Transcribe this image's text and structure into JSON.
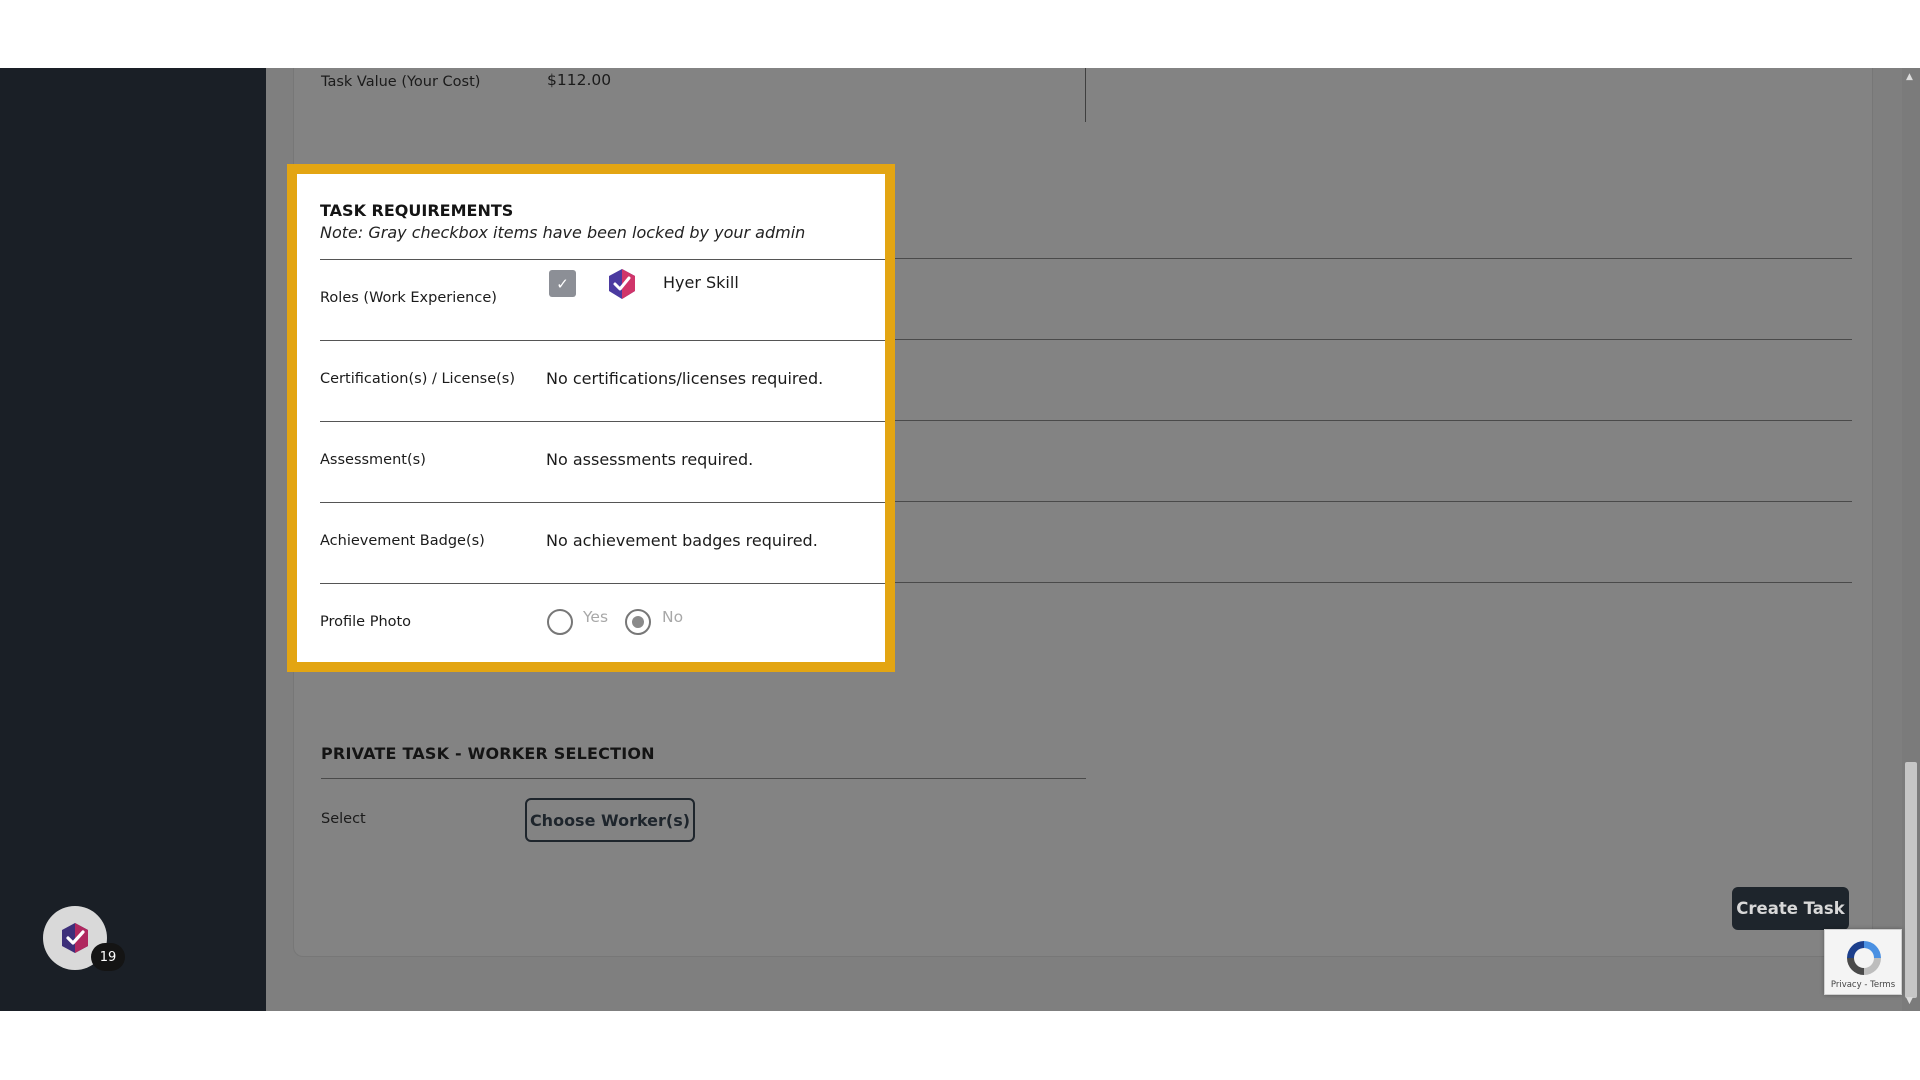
{
  "task_value": {
    "label": "Task Value (Your Cost)",
    "value": "$112.00"
  },
  "requirements": {
    "title": "TASK REQUIREMENTS",
    "note": "Note: Gray checkbox items have been locked by your admin",
    "roles_label": "Roles (Work Experience)",
    "role_name": "Hyer Skill",
    "role_checked": true,
    "certifications_label": "Certification(s) / License(s)",
    "certifications_value": "No certifications/licenses required.",
    "assessments_label": "Assessment(s)",
    "assessments_value": "No assessments required.",
    "badges_label": "Achievement Badge(s)",
    "badges_value": "No achievement badges required.",
    "photo_label": "Profile Photo",
    "photo_yes": "Yes",
    "photo_no": "No",
    "photo_selected": "No"
  },
  "worker_selection": {
    "title": "PRIVATE TASK - WORKER SELECTION",
    "select_label": "Select",
    "choose_button": "Choose Worker(s)"
  },
  "create_button": "Create Task",
  "notification_count": "19",
  "recaptcha_text": "Privacy - Terms",
  "colors": {
    "highlight": "#e3a512",
    "sidebar": "#1a1f26",
    "overlay": "#7f7f7f",
    "brand_purple": "#5b3fa8",
    "brand_pink": "#d0356a"
  },
  "icons": {
    "role_badge": "hyer-shield-check-icon",
    "checkbox": "checkmark-icon",
    "avatar": "hyer-logo-icon",
    "recaptcha": "recaptcha-icon",
    "scroll_up": "scroll-up-arrow-icon",
    "scroll_down": "scroll-down-arrow-icon"
  }
}
